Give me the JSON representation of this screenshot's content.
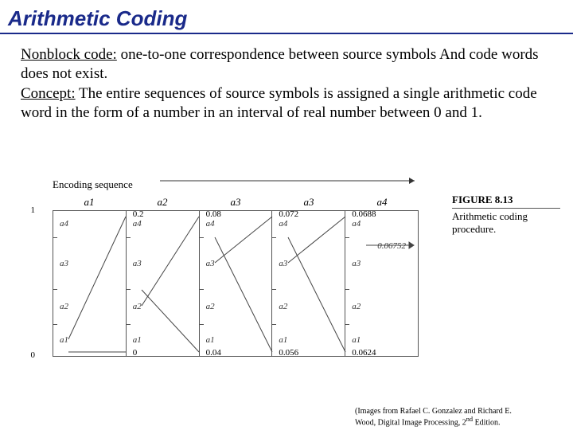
{
  "title": "Arithmetic Coding",
  "paragraph": {
    "u1": "Nonblock code:",
    "p1": " one-to-one correspondence between source symbols And code words does not exist.",
    "u2": "Concept:",
    "p2": " The entire sequences of source symbols is assigned a single arithmetic code word in the form of a number in an interval of real number between 0 and 1."
  },
  "figure": {
    "seq_label": "Encoding sequence",
    "seq": [
      "a1",
      "a2",
      "a3",
      "a3",
      "a4"
    ],
    "left_scale": [
      "1",
      "0"
    ],
    "a_labels": [
      "a4",
      "a3",
      "a2",
      "a1"
    ],
    "columns": [
      {
        "top": "1",
        "bot": "0"
      },
      {
        "top": "0.2",
        "bot": "0"
      },
      {
        "top": "0.08",
        "bot": "0.04"
      },
      {
        "top": "0.072",
        "bot": "0.056"
      },
      {
        "top": "0.0688",
        "bot": "0.0624",
        "extra": "0.06752"
      }
    ],
    "fignum": "FIGURE 8.13",
    "figtxt": "Arithmetic coding procedure."
  },
  "credit": {
    "l1": "(Images from Rafael C. Gonzalez and Richard E.",
    "l2": "Wood, Digital Image Processing, 2",
    "sup": "nd",
    "l3": " Edition."
  }
}
